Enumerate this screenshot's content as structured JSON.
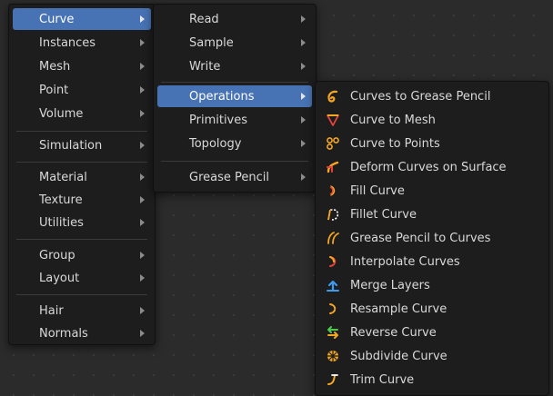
{
  "add_menu": {
    "items": [
      {
        "label": "Curve",
        "active": true
      },
      {
        "label": "Instances"
      },
      {
        "label": "Mesh"
      },
      {
        "label": "Point"
      },
      {
        "label": "Volume"
      },
      {
        "label": "Simulation"
      },
      {
        "label": "Material"
      },
      {
        "label": "Texture"
      },
      {
        "label": "Utilities"
      },
      {
        "label": "Group"
      },
      {
        "label": "Layout"
      },
      {
        "label": "Hair"
      },
      {
        "label": "Normals"
      }
    ]
  },
  "curve_menu": {
    "items": [
      {
        "label": "Read"
      },
      {
        "label": "Sample"
      },
      {
        "label": "Write"
      },
      {
        "label": "Operations",
        "active": true
      },
      {
        "label": "Primitives"
      },
      {
        "label": "Topology"
      },
      {
        "label": "Grease Pencil"
      }
    ]
  },
  "operations_menu": {
    "items": [
      {
        "label": "Curves to Grease Pencil",
        "icon": "curves-to-grease-pencil-icon"
      },
      {
        "label": "Curve to Mesh",
        "icon": "curve-to-mesh-icon"
      },
      {
        "label": "Curve to Points",
        "icon": "curve-to-points-icon"
      },
      {
        "label": "Deform Curves on Surface",
        "icon": "deform-curves-on-surface-icon"
      },
      {
        "label": "Fill Curve",
        "icon": "fill-curve-icon"
      },
      {
        "label": "Fillet Curve",
        "icon": "fillet-curve-icon"
      },
      {
        "label": "Grease Pencil to Curves",
        "icon": "grease-pencil-to-curves-icon"
      },
      {
        "label": "Interpolate Curves",
        "icon": "interpolate-curves-icon"
      },
      {
        "label": "Merge Layers",
        "icon": "merge-layers-icon"
      },
      {
        "label": "Resample Curve",
        "icon": "resample-curve-icon"
      },
      {
        "label": "Reverse Curve",
        "icon": "reverse-curve-icon"
      },
      {
        "label": "Subdivide Curve",
        "icon": "subdivide-curve-icon"
      },
      {
        "label": "Trim Curve",
        "icon": "trim-curve-icon"
      }
    ]
  },
  "colors": {
    "highlight": "#4772b3",
    "menu_bg": "#1d1d1d",
    "canvas_bg": "#2b2b2b",
    "icon_orange": "#f5a623",
    "icon_red": "#e8423a",
    "icon_blue": "#3d9bf0",
    "icon_green": "#4cc94c"
  }
}
